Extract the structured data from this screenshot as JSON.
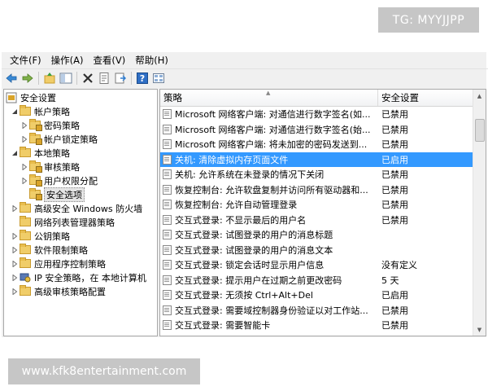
{
  "watermark_top": "TG: MYYJJPP",
  "watermark_bottom": "www.kfk8entertainment.com",
  "menubar": {
    "items": [
      "文件(F)",
      "操作(A)",
      "查看(V)",
      "帮助(H)"
    ]
  },
  "toolbar": {
    "icons": [
      "back-arrow-icon",
      "forward-arrow-icon",
      "up-folder-icon",
      "show-hide-tree-icon",
      "delete-icon",
      "properties-icon",
      "export-icon",
      "help-icon",
      "view-icon"
    ]
  },
  "tree": {
    "items": [
      {
        "label": "安全设置",
        "level": 0,
        "arrow": "none",
        "icon": "security-settings-icon"
      },
      {
        "label": "帐户策略",
        "level": 1,
        "arrow": "expanded",
        "icon": "folder-icon"
      },
      {
        "label": "密码策略",
        "level": 2,
        "arrow": "collapsed",
        "icon": "folder-icon"
      },
      {
        "label": "帐户锁定策略",
        "level": 2,
        "arrow": "collapsed",
        "icon": "folder-icon"
      },
      {
        "label": "本地策略",
        "level": 1,
        "arrow": "expanded",
        "icon": "folder-icon"
      },
      {
        "label": "审核策略",
        "level": 2,
        "arrow": "collapsed",
        "icon": "folder-icon"
      },
      {
        "label": "用户权限分配",
        "level": 2,
        "arrow": "collapsed",
        "icon": "folder-icon"
      },
      {
        "label": "安全选项",
        "level": 2,
        "arrow": "none",
        "icon": "folder-icon",
        "selected": true
      },
      {
        "label": "高级安全 Windows 防火墙",
        "level": 1,
        "arrow": "collapsed",
        "icon": "folder-icon"
      },
      {
        "label": "网络列表管理器策略",
        "level": 1,
        "arrow": "none",
        "icon": "folder-icon"
      },
      {
        "label": "公钥策略",
        "level": 1,
        "arrow": "collapsed",
        "icon": "folder-icon"
      },
      {
        "label": "软件限制策略",
        "level": 1,
        "arrow": "collapsed",
        "icon": "folder-icon"
      },
      {
        "label": "应用程序控制策略",
        "level": 1,
        "arrow": "collapsed",
        "icon": "folder-icon"
      },
      {
        "label": "IP 安全策略，在 本地计算机",
        "level": 1,
        "arrow": "collapsed",
        "icon": "ip-security-icon"
      },
      {
        "label": "高级审核策略配置",
        "level": 1,
        "arrow": "collapsed",
        "icon": "folder-icon"
      }
    ]
  },
  "list": {
    "headers": [
      "策略",
      "安全设置"
    ],
    "rows": [
      {
        "policy": "Microsoft 网络客户端: 对通信进行数字签名(如...",
        "setting": "已禁用"
      },
      {
        "policy": "Microsoft 网络客户端: 对通信进行数字签名(始...",
        "setting": "已禁用"
      },
      {
        "policy": "Microsoft 网络客户端: 将未加密的密码发送到...",
        "setting": "已禁用"
      },
      {
        "policy": "关机: 清除虚拟内存页面文件",
        "setting": "已启用",
        "selected": true
      },
      {
        "policy": "关机: 允许系统在未登录的情况下关闭",
        "setting": "已禁用"
      },
      {
        "policy": "恢复控制台: 允许软盘复制并访问所有驱动器和...",
        "setting": "已禁用"
      },
      {
        "policy": "恢复控制台: 允许自动管理登录",
        "setting": "已禁用"
      },
      {
        "policy": "交互式登录: 不显示最后的用户名",
        "setting": "已禁用"
      },
      {
        "policy": "交互式登录: 试图登录的用户的消息标题",
        "setting": ""
      },
      {
        "policy": "交互式登录: 试图登录的用户的消息文本",
        "setting": ""
      },
      {
        "policy": "交互式登录: 锁定会话时显示用户信息",
        "setting": "没有定义"
      },
      {
        "policy": "交互式登录: 提示用户在过期之前更改密码",
        "setting": "5 天"
      },
      {
        "policy": "交互式登录: 无须按 Ctrl+Alt+Del",
        "setting": "已启用"
      },
      {
        "policy": "交互式登录: 需要域控制器身份验证以对工作站...",
        "setting": "已禁用"
      },
      {
        "policy": "交互式登录: 需要智能卡",
        "setting": "已禁用"
      }
    ]
  },
  "colors": {
    "selection": "#3399ff",
    "folder": "#f0cd69",
    "window_bg": "#f0f0f0"
  }
}
